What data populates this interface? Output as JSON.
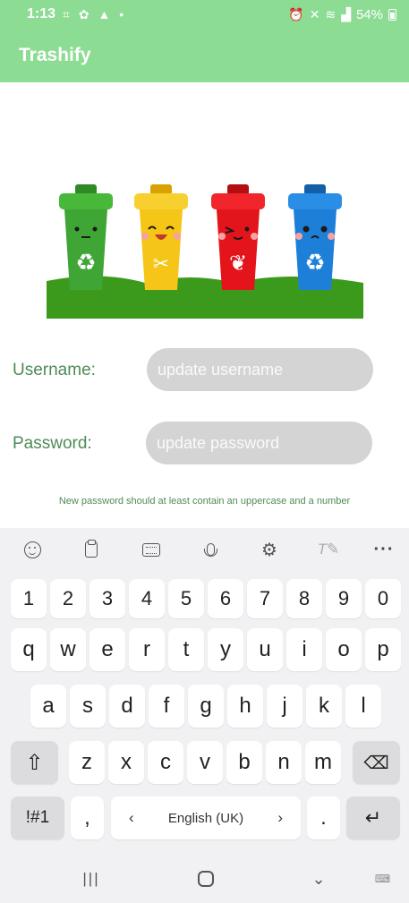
{
  "status_bar": {
    "time": "1:13",
    "left_icons": [
      "screenshot-icon",
      "gesture-icon",
      "alert-icon",
      "dot-icon"
    ],
    "right_icons": [
      "alarm-icon",
      "mute-icon",
      "wifi-icon",
      "volte-icon",
      "signal-icon"
    ],
    "battery": "54%"
  },
  "app_bar": {
    "title": "Trashify"
  },
  "hero_image": {
    "bins": [
      {
        "color": "#3fa535",
        "icon": "recycle-icon"
      },
      {
        "color": "#f5c518",
        "icon": "utensils-icon"
      },
      {
        "color": "#e4141b",
        "icon": "leaf-icon"
      },
      {
        "color": "#1e7fd8",
        "icon": "recycle-arrows-icon"
      }
    ],
    "ground_color": "#3b9a1c"
  },
  "form": {
    "username_label": "Username:",
    "username_placeholder": "update username",
    "password_label": "Password:",
    "password_placeholder": "update password",
    "hint": "New password should at least contain an uppercase and a number"
  },
  "colors": {
    "accent": "#8ddc94",
    "label_green": "#4f8b55",
    "input_bg": "#d4d4d4"
  },
  "keyboard": {
    "toolbar": [
      "emoji-icon",
      "clipboard-icon",
      "keyboard-icon",
      "mic-icon",
      "settings-icon",
      "handwriting-icon",
      "more-icon"
    ],
    "number_row": [
      "1",
      "2",
      "3",
      "4",
      "5",
      "6",
      "7",
      "8",
      "9",
      "0"
    ],
    "row1": [
      "q",
      "w",
      "e",
      "r",
      "t",
      "y",
      "u",
      "i",
      "o",
      "p"
    ],
    "row2": [
      "a",
      "s",
      "d",
      "f",
      "g",
      "h",
      "j",
      "k",
      "l"
    ],
    "row3": [
      "z",
      "x",
      "c",
      "v",
      "b",
      "n",
      "m"
    ],
    "symbols_label": "!#1",
    "comma": ",",
    "space_language": "English (UK)",
    "period": "."
  },
  "nav_bar": [
    "recents-icon",
    "home-icon",
    "back-icon",
    "keyboard-switch-icon"
  ]
}
